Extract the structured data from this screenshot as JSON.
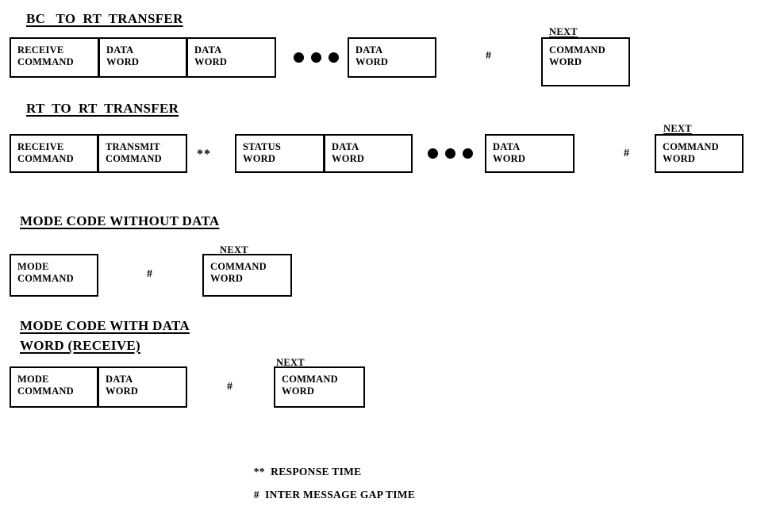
{
  "sections": [
    {
      "id": "bc-to-rt-transfer",
      "title": "BC   TO  RT  TRANSFER",
      "boxes": [
        {
          "line1": "RECEIVE",
          "line2": "COMMAND"
        },
        {
          "line1": "DATA",
          "line2": "WORD"
        },
        {
          "line1": "DATA",
          "line2": "WORD"
        },
        {
          "line1": "DATA",
          "line2": "WORD"
        }
      ],
      "next_label": "NEXT",
      "next_box": {
        "line1": "COMMAND",
        "line2": "WORD"
      },
      "gap_marker": "#"
    },
    {
      "id": "rt-to-rt-transfer",
      "title": "RT  TO  RT  TRANSFER",
      "boxes": [
        {
          "line1": "RECEIVE",
          "line2": "COMMAND"
        },
        {
          "line1": "TRANSMIT",
          "line2": "COMMAND"
        },
        {
          "line1": "STATUS",
          "line2": "WORD"
        },
        {
          "line1": "DATA",
          "line2": "WORD"
        },
        {
          "line1": "DATA",
          "line2": "WORD"
        }
      ],
      "response_marker": "**",
      "next_label": "NEXT",
      "next_box": {
        "line1": "COMMAND",
        "line2": "WORD"
      },
      "gap_marker": "#"
    },
    {
      "id": "mode-code-without-data",
      "title": "MODE CODE WITHOUT DATA",
      "boxes": [
        {
          "line1": "MODE",
          "line2": "COMMAND"
        }
      ],
      "next_label": "NEXT",
      "next_box": {
        "line1": "COMMAND",
        "line2": "WORD"
      },
      "gap_marker": "#"
    },
    {
      "id": "mode-code-with-data-word-receive",
      "title_line1": "MODE CODE WITH DATA",
      "title_line2": "WORD (RECEIVE)",
      "boxes": [
        {
          "line1": "MODE",
          "line2": "COMMAND"
        },
        {
          "line1": "DATA",
          "line2": "WORD"
        }
      ],
      "next_label": "NEXT",
      "next_box": {
        "line1": "COMMAND",
        "line2": "WORD"
      },
      "gap_marker": "#"
    }
  ],
  "legend": [
    {
      "symbol": "**",
      "text": "RESPONSE TIME"
    },
    {
      "symbol": "#",
      "text": "INTER MESSAGE GAP TIME"
    }
  ],
  "colors": {
    "background": "#ffffff",
    "ink": "#000000",
    "border": "#000000"
  }
}
